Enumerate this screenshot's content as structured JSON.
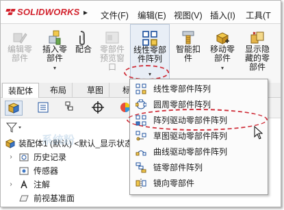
{
  "app": {
    "brand": "SOLIDWORKS",
    "brand_prefix": "3S"
  },
  "menubar": {
    "items": [
      {
        "label": "文件(F)"
      },
      {
        "label": "编辑(E)"
      },
      {
        "label": "视图(V)"
      },
      {
        "label": "插入(I)"
      },
      {
        "label": "工具(T"
      }
    ]
  },
  "ribbon": {
    "buttons": [
      {
        "label": "编辑零\n部件",
        "state": "disabled",
        "icon": "edit-component-icon"
      },
      {
        "label": "插入零\n部件",
        "state": "enabled",
        "icon": "insert-component-icon"
      },
      {
        "label": "配合",
        "state": "enabled",
        "icon": "mate-icon"
      },
      {
        "label": "零部件\n预览窗\n口",
        "state": "disabled",
        "icon": "component-preview-icon"
      },
      {
        "label": "线性零部\n件阵列",
        "state": "open",
        "icon": "linear-pattern-icon"
      },
      {
        "label": "智能扣\n件",
        "state": "enabled",
        "icon": "smart-fasteners-icon"
      },
      {
        "label": "移动零\n部件",
        "state": "enabled",
        "icon": "move-component-icon"
      },
      {
        "label": "显示隐\n藏的零\n部件",
        "state": "enabled",
        "icon": "show-hidden-components-icon"
      }
    ],
    "dropdown_arrow": "▾"
  },
  "tabs": [
    {
      "label": "装配体",
      "active": true
    },
    {
      "label": "布局",
      "active": false
    },
    {
      "label": "草图",
      "active": false
    },
    {
      "label": "标",
      "active": false
    }
  ],
  "panel_toolbar": {
    "buttons": [
      {
        "icon": "feature-manager-icon",
        "active": true
      },
      {
        "icon": "property-manager-icon",
        "active": false
      },
      {
        "icon": "configuration-manager-icon",
        "active": false
      },
      {
        "icon": "dimxpert-icon",
        "active": false
      },
      {
        "icon": "display-manager-icon",
        "active": false
      }
    ]
  },
  "tree": {
    "root": "装配体1 (默认) <默认_显示状态",
    "items": [
      {
        "label": "历史记录",
        "icon": "history-icon",
        "expandable": true
      },
      {
        "label": "传感器",
        "icon": "sensors-icon",
        "expandable": false
      },
      {
        "label": "注解",
        "icon": "annotations-icon",
        "expandable": true
      },
      {
        "label": "前视基准面",
        "icon": "plane-icon",
        "expandable": false
      }
    ]
  },
  "pattern_menu": {
    "items": [
      {
        "label": "线性零部件阵列",
        "icon": "linear-pattern-icon"
      },
      {
        "label": "圆周零部件阵列",
        "icon": "circular-pattern-icon"
      },
      {
        "label": "阵列驱动零部件阵列",
        "icon": "pattern-driven-icon"
      },
      {
        "label": "草图驱动零部件阵列",
        "icon": "sketch-driven-icon"
      },
      {
        "label": "曲线驱动零部件阵列",
        "icon": "curve-driven-icon"
      },
      {
        "label": "链零部件阵列",
        "icon": "chain-pattern-icon"
      },
      {
        "label": "镜向零部件",
        "icon": "mirror-components-icon"
      }
    ]
  },
  "watermark": "系统粉",
  "colors": {
    "brand_red": "#d2202b",
    "annotation_red": "#cf2f3a",
    "pattern_blue": "#1b4f9c"
  }
}
